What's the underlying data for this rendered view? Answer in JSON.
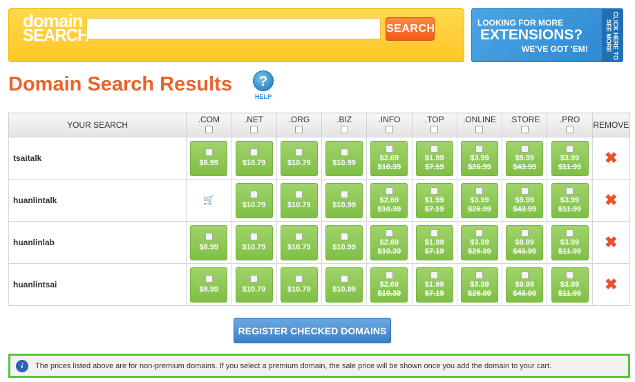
{
  "header": {
    "logo_line1": "domain",
    "logo_line2": "SEARCH",
    "search_placeholder": "",
    "search_label": "SEARCH"
  },
  "promo": {
    "line1": "LOOKING FOR MORE",
    "line2": "EXTENSIONS?",
    "line3": "WE'VE GOT 'EM!",
    "side": "CLICK HERE TO SEE MORE"
  },
  "title": "Domain Search Results",
  "help_label": "HELP",
  "table": {
    "your_search": "YOUR SEARCH",
    "remove": "REMOVE",
    "tlds": [
      ".COM",
      ".NET",
      ".ORG",
      ".BIZ",
      ".INFO",
      ".TOP",
      ".ONLINE",
      ".STORE",
      ".PRO"
    ],
    "rows": [
      {
        "name": "tsaitalk",
        "cells": [
          {
            "type": "price",
            "price": "$8.99"
          },
          {
            "type": "price",
            "price": "$10.79"
          },
          {
            "type": "price",
            "price": "$10.79"
          },
          {
            "type": "price",
            "price": "$10.99"
          },
          {
            "type": "sale",
            "price": "$2.69",
            "old": "$10.39"
          },
          {
            "type": "sale",
            "price": "$1.99",
            "old": "$7.19"
          },
          {
            "type": "sale",
            "price": "$3.99",
            "old": "$26.99"
          },
          {
            "type": "sale",
            "price": "$9.99",
            "old": "$43.99"
          },
          {
            "type": "sale",
            "price": "$3.99",
            "old": "$11.99"
          }
        ]
      },
      {
        "name": "huanlintalk",
        "cells": [
          {
            "type": "cart"
          },
          {
            "type": "price",
            "price": "$10.79"
          },
          {
            "type": "price",
            "price": "$10.79"
          },
          {
            "type": "price",
            "price": "$10.99"
          },
          {
            "type": "sale",
            "price": "$2.69",
            "old": "$10.39"
          },
          {
            "type": "sale",
            "price": "$1.99",
            "old": "$7.19"
          },
          {
            "type": "sale",
            "price": "$3.99",
            "old": "$26.99"
          },
          {
            "type": "sale",
            "price": "$9.99",
            "old": "$43.99"
          },
          {
            "type": "sale",
            "price": "$3.99",
            "old": "$11.99"
          }
        ]
      },
      {
        "name": "huanlinlab",
        "cells": [
          {
            "type": "price",
            "price": "$8.99"
          },
          {
            "type": "price",
            "price": "$10.79"
          },
          {
            "type": "price",
            "price": "$10.79"
          },
          {
            "type": "price",
            "price": "$10.99"
          },
          {
            "type": "sale",
            "price": "$2.69",
            "old": "$10.39"
          },
          {
            "type": "sale",
            "price": "$1.99",
            "old": "$7.19"
          },
          {
            "type": "sale",
            "price": "$3.99",
            "old": "$26.99"
          },
          {
            "type": "sale",
            "price": "$9.99",
            "old": "$43.99"
          },
          {
            "type": "sale",
            "price": "$3.99",
            "old": "$11.99"
          }
        ]
      },
      {
        "name": "huanlintsai",
        "cells": [
          {
            "type": "price",
            "price": "$8.99"
          },
          {
            "type": "price",
            "price": "$10.79"
          },
          {
            "type": "price",
            "price": "$10.79"
          },
          {
            "type": "price",
            "price": "$10.99"
          },
          {
            "type": "sale",
            "price": "$2.69",
            "old": "$10.39"
          },
          {
            "type": "sale",
            "price": "$1.99",
            "old": "$7.19"
          },
          {
            "type": "sale",
            "price": "$3.99",
            "old": "$26.99"
          },
          {
            "type": "sale",
            "price": "$9.99",
            "old": "$43.99"
          },
          {
            "type": "sale",
            "price": "$3.99",
            "old": "$11.99"
          }
        ]
      }
    ]
  },
  "register_label": "REGISTER CHECKED DOMAINS",
  "notice": "The prices listed above are for non-premium domains. If you select a premium domain, the sale price will be shown once you add the domain to your cart.",
  "icons": {
    "remove": "close-x-icon",
    "cart": "shopping-cart-icon",
    "help": "question-mark-icon",
    "info": "info-icon"
  },
  "colors": {
    "accent_orange": "#e8632b",
    "price_green": "#8ac654",
    "notice_border": "#5ec23b",
    "register_blue": "#3a7fc6"
  }
}
